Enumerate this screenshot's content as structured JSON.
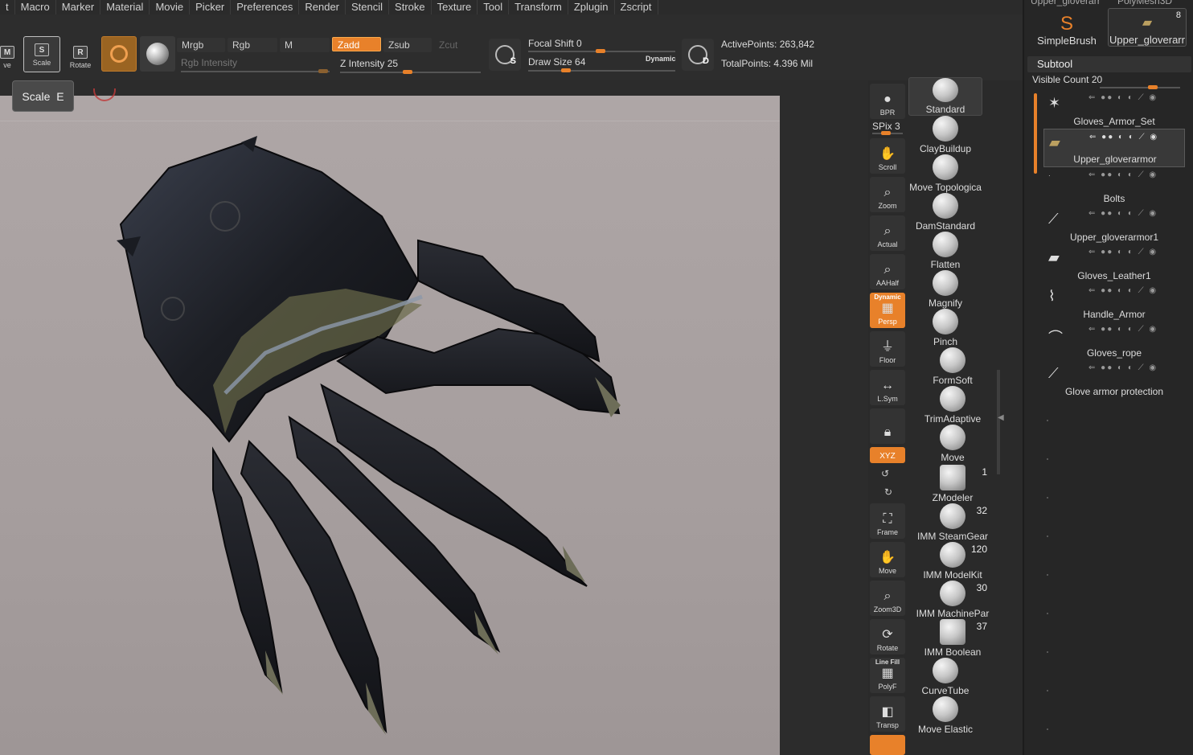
{
  "menu": [
    "t",
    "Macro",
    "Marker",
    "Material",
    "Movie",
    "Picker",
    "Preferences",
    "Render",
    "Stencil",
    "Stroke",
    "Texture",
    "Tool",
    "Transform",
    "Zplugin",
    "Zscript"
  ],
  "toolbar": {
    "move_mode": {
      "key": "M",
      "label": "ve"
    },
    "scale_mode": {
      "key": "S",
      "label": "Scale"
    },
    "rotate_mode": {
      "key": "R",
      "label": "Rotate"
    },
    "mrgb": "Mrgb",
    "rgb": "Rgb",
    "m": "M",
    "zadd": "Zadd",
    "zsub": "Zsub",
    "zcut": "Zcut",
    "rgb_intensity": "Rgb Intensity",
    "z_intensity_label": "Z Intensity",
    "z_intensity": 25,
    "s_letter": "S",
    "d_letter": "D",
    "focal_shift_label": "Focal Shift",
    "focal_shift": 0,
    "draw_size_label": "Draw Size",
    "draw_size": 64,
    "dynamic": "Dynamic",
    "active_points_label": "ActivePoints:",
    "active_points": "263,842",
    "total_points_label": "TotalPoints:",
    "total_points": "4.396 Mil"
  },
  "tooltip": {
    "name": "Scale",
    "key": "E"
  },
  "shelf": [
    {
      "label": "BPR",
      "icon": "sphere-icon"
    },
    {
      "label": "SPix 3",
      "icon": "slider-icon"
    },
    {
      "label": "Scroll",
      "icon": "hand-icon"
    },
    {
      "label": "Zoom",
      "icon": "magnifier-icon"
    },
    {
      "label": "Actual",
      "icon": "magnifier-icon"
    },
    {
      "label": "AAHalf",
      "icon": "magnifier-icon"
    },
    {
      "label": "Persp",
      "top": "Dynamic",
      "icon": "grid-icon"
    },
    {
      "label": "Floor",
      "icon": "floor-icon"
    },
    {
      "label": "L.Sym",
      "icon": "symmetry-icon"
    },
    {
      "label": "",
      "icon": "lock-icon"
    },
    {
      "label": "XYZ",
      "icon": "axis-icon"
    },
    {
      "label": "",
      "icon": "rotate-y-icon"
    },
    {
      "label": "",
      "icon": "rotate-z-icon"
    },
    {
      "label": "Frame",
      "icon": "frame-icon"
    },
    {
      "label": "Move",
      "icon": "hand-icon"
    },
    {
      "label": "Zoom3D",
      "icon": "magnifier-icon"
    },
    {
      "label": "Rotate",
      "icon": "rotate-icon"
    },
    {
      "label": "PolyF",
      "top": "Line Fill",
      "icon": "grid-icon"
    },
    {
      "label": "Transp",
      "icon": "transp-icon"
    }
  ],
  "brushes": [
    {
      "name": "Standard",
      "count": ""
    },
    {
      "name": "ClayBuildup",
      "count": ""
    },
    {
      "name": "Move Topologica",
      "count": ""
    },
    {
      "name": "DamStandard",
      "count": ""
    },
    {
      "name": "Flatten",
      "count": ""
    },
    {
      "name": "Magnify",
      "count": ""
    },
    {
      "name": "Pinch",
      "count": ""
    },
    {
      "name": "FormSoft",
      "count": ""
    },
    {
      "name": "TrimAdaptive",
      "count": ""
    },
    {
      "name": "Move",
      "count": ""
    },
    {
      "name": "ZModeler",
      "count": "1"
    },
    {
      "name": "IMM SteamGear",
      "count": "32"
    },
    {
      "name": "IMM ModelKit",
      "count": "120"
    },
    {
      "name": "IMM MachinePar",
      "count": "30"
    },
    {
      "name": "IMM Boolean",
      "count": "37"
    },
    {
      "name": "CurveTube",
      "count": ""
    },
    {
      "name": "Move Elastic",
      "count": ""
    }
  ],
  "tool": {
    "top_left": "Upper_gloverarr",
    "top_right": "PolyMesh3D",
    "left_name": "SimpleBrush",
    "right_name": "Upper_gloverarr",
    "right_count": "8"
  },
  "subtool": {
    "title": "Subtool",
    "visible_count_label": "Visible Count",
    "visible_count": 20,
    "items": [
      {
        "name": "Gloves_Armor_Set",
        "thumb": "star-icon"
      },
      {
        "name": "Upper_gloverarmor",
        "thumb": "mesh-icon"
      },
      {
        "name": "Bolts",
        "thumb": "mesh-icon"
      },
      {
        "name": "Upper_gloverarmor1",
        "thumb": "mesh-icon"
      },
      {
        "name": "Gloves_Leather1",
        "thumb": "mesh-icon"
      },
      {
        "name": "Handle_Armor",
        "thumb": "mesh-icon"
      },
      {
        "name": "Gloves_rope",
        "thumb": "mesh-icon"
      },
      {
        "name": "Glove armor protection",
        "thumb": "mesh-icon"
      }
    ]
  }
}
